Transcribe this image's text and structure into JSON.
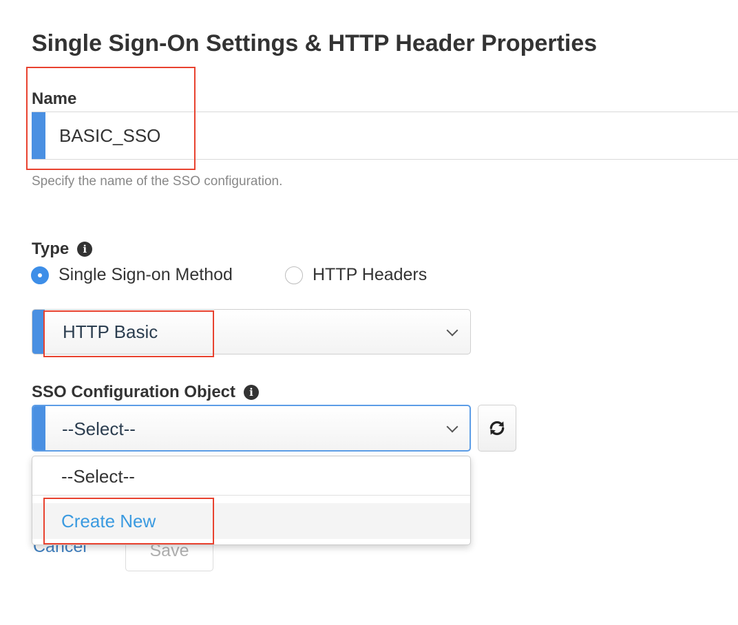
{
  "page_title": "Single Sign-On Settings & HTTP Header Properties",
  "name_field": {
    "label": "Name",
    "value": "BASIC_SSO",
    "help": "Specify the name of the SSO configuration."
  },
  "type_field": {
    "label": "Type",
    "options": [
      {
        "label": "Single Sign-on Method",
        "checked": true
      },
      {
        "label": "HTTP Headers",
        "checked": false
      }
    ],
    "method_select_value": "HTTP Basic"
  },
  "sso_object_field": {
    "label": "SSO Configuration Object",
    "select_value": "--Select--",
    "dropdown_options": [
      "--Select--",
      "Create New"
    ]
  },
  "footer": {
    "cancel_label": "Cancel",
    "save_label": "Save"
  },
  "colors": {
    "accent_bar": "#4a90e2",
    "radio_checked": "#3d8ee8",
    "link": "#3a9ae0",
    "highlight_box": "#e8412e"
  },
  "icons": {
    "info": "info-circle-icon",
    "refresh": "refresh-icon",
    "dropdown": "chevron-down-icon"
  }
}
